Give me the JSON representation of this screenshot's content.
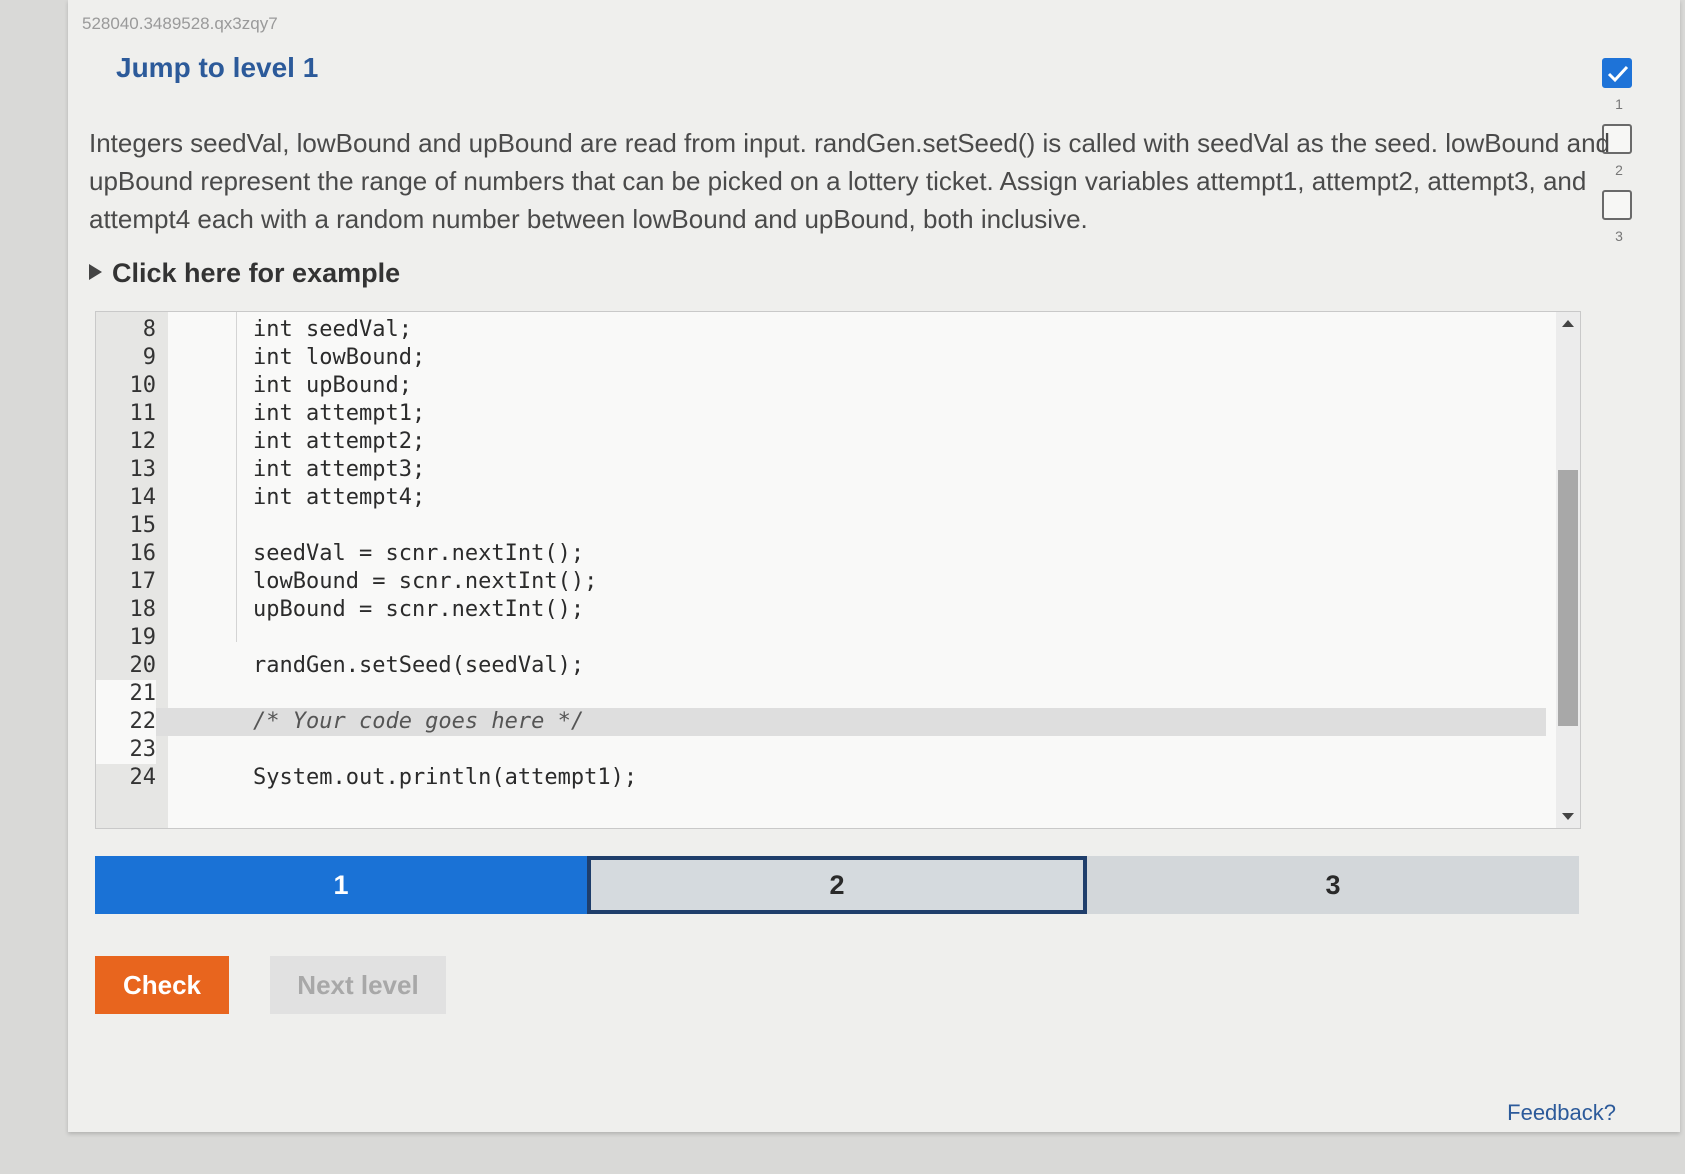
{
  "activity_id": "528040.3489528.qx3zqy7",
  "title": "Jump to level 1",
  "instructions": "Integers seedVal, lowBound and upBound are read from input. randGen.setSeed() is called with seedVal as the seed. lowBound and upBound represent the range of numbers that can be picked on a lottery ticket. Assign variables attempt1, attempt2, attempt3, and attempt4 each with a random number between lowBound and upBound, both inclusive.",
  "example_toggle_label": "Click here for example",
  "level_tracker": {
    "levels": [
      {
        "label": "1",
        "completed": true
      },
      {
        "label": "2",
        "completed": false
      },
      {
        "label": "3",
        "completed": false
      }
    ]
  },
  "editor": {
    "lines": [
      {
        "num": "8",
        "code": "int seedVal;"
      },
      {
        "num": "9",
        "code": "int lowBound;"
      },
      {
        "num": "10",
        "code": "int upBound;"
      },
      {
        "num": "11",
        "code": "int attempt1;"
      },
      {
        "num": "12",
        "code": "int attempt2;"
      },
      {
        "num": "13",
        "code": "int attempt3;"
      },
      {
        "num": "14",
        "code": "int attempt4;"
      },
      {
        "num": "15",
        "code": ""
      },
      {
        "num": "16",
        "code": "seedVal = scnr.nextInt();"
      },
      {
        "num": "17",
        "code": "lowBound = scnr.nextInt();"
      },
      {
        "num": "18",
        "code": "upBound = scnr.nextInt();"
      },
      {
        "num": "19",
        "code": ""
      },
      {
        "num": "20",
        "code": "randGen.setSeed(seedVal);"
      },
      {
        "num": "21",
        "code": ""
      },
      {
        "num": "22",
        "code": "/* Your code goes here */"
      },
      {
        "num": "23",
        "code": ""
      },
      {
        "num": "24",
        "code": "System.out.println(attempt1);"
      }
    ]
  },
  "progress": {
    "segments": [
      {
        "label": "1",
        "state": "complete"
      },
      {
        "label": "2",
        "state": "current"
      },
      {
        "label": "3",
        "state": "upcoming"
      }
    ]
  },
  "buttons": {
    "check": "Check",
    "next_level": "Next level"
  },
  "feedback_link": "Feedback?",
  "colors": {
    "accent_blue": "#1a72d6",
    "check_orange": "#e8651e",
    "title_blue": "#2c5a9a"
  }
}
